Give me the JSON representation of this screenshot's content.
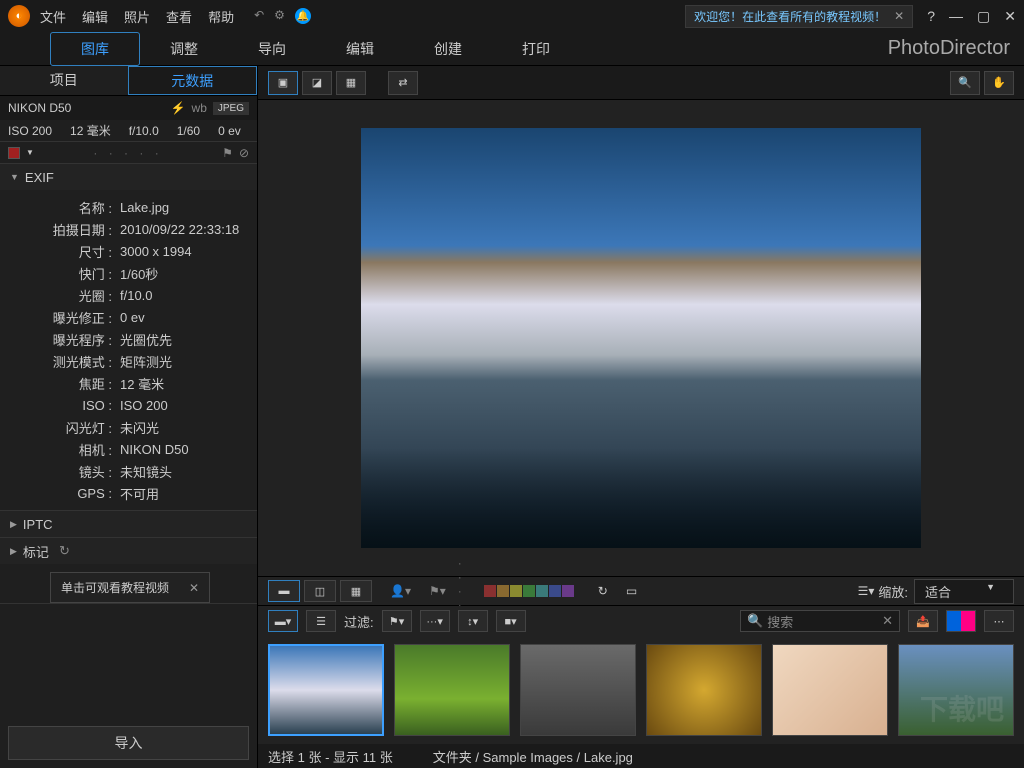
{
  "menu": {
    "file": "文件",
    "edit": "编辑",
    "photo": "照片",
    "view": "查看",
    "help": "帮助"
  },
  "welcome": "欢迎您！在此查看所有的教程视频！",
  "brand": "PhotoDirector",
  "maintabs": {
    "library": "图库",
    "adjust": "调整",
    "guide": "导向",
    "edit": "编辑",
    "create": "创建",
    "print": "打印"
  },
  "lefttabs": {
    "project": "项目",
    "metadata": "元数据"
  },
  "camera": {
    "model": "NIKON D50",
    "format": "JPEG"
  },
  "info": {
    "iso": "ISO 200",
    "focal": "12 毫米",
    "aperture": "f/10.0",
    "shutter": "1/60",
    "ev": "0 ev"
  },
  "sections": {
    "exif": "EXIF",
    "iptc": "IPTC",
    "tags": "标记"
  },
  "exif": [
    {
      "k": "名称",
      "v": "Lake.jpg"
    },
    {
      "k": "拍摄日期",
      "v": "2010/09/22 22:33:18"
    },
    {
      "k": "尺寸",
      "v": "3000 x 1994"
    },
    {
      "k": "快门",
      "v": "1/60秒"
    },
    {
      "k": "光圈",
      "v": "f/10.0"
    },
    {
      "k": "曝光修正",
      "v": "0 ev"
    },
    {
      "k": "曝光程序",
      "v": "光圈优先"
    },
    {
      "k": "测光模式",
      "v": "矩阵测光"
    },
    {
      "k": "焦距",
      "v": "12 毫米"
    },
    {
      "k": "ISO",
      "v": "ISO 200"
    },
    {
      "k": "闪光灯",
      "v": "未闪光"
    },
    {
      "k": "相机",
      "v": "NIKON D50"
    },
    {
      "k": "镜头",
      "v": "未知镜头"
    },
    {
      "k": "GPS",
      "v": "不可用"
    }
  ],
  "tooltip": "单击可观看教程视频",
  "import": "导入",
  "filter_label": "过滤:",
  "zoom": {
    "label": "缩放:",
    "value": "适合"
  },
  "search_placeholder": "搜索",
  "status": {
    "selection": "选择 1 张 - 显示 11 张",
    "folder_label": "文件夹",
    "path": "Sample Images / Lake.jpg"
  },
  "palette": [
    "#8a3030",
    "#8a6a30",
    "#8a8a30",
    "#3a7a3a",
    "#3a7a7a",
    "#3a4a8a",
    "#6a3a8a"
  ]
}
